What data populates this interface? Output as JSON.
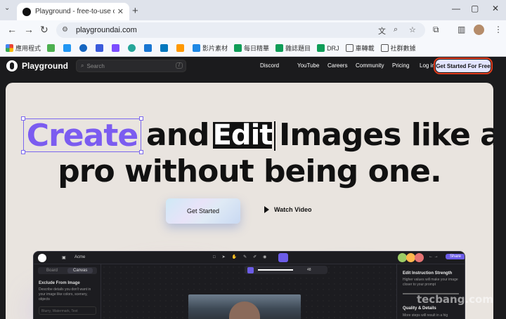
{
  "browser": {
    "tab_title": "Playground - free-to-use onli",
    "url": "playgroundai.com",
    "bookmarks": [
      "應用程式",
      "影片素材",
      "每日精華",
      "雜誌題目",
      "DRJ",
      "車轉載",
      "社群數據"
    ]
  },
  "site": {
    "logo": "Playground",
    "search_placeholder": "Search",
    "search_shortcut": "/",
    "nav": [
      "Discord",
      "YouTube",
      "Careers",
      "Community",
      "Pricing",
      "Log in"
    ],
    "cta": "Get Started For Free"
  },
  "hero": {
    "word_create": "Create",
    "word_and": "and",
    "word_edit": "Edit",
    "line1_rest": "Images like a",
    "line2": "pro without being one.",
    "get_started": "Get Started",
    "watch_video": "Watch Video"
  },
  "app_preview": {
    "project": "Acme",
    "tab_board": "Board",
    "tab_canvas": "Canvas",
    "exclude_title": "Exclude From Image",
    "exclude_desc": "Describe details you don't want in your image like colors, scenery, objects",
    "exclude_placeholder": "Blurry, Watermark, Text",
    "zoom_value": "48",
    "share": "Share",
    "edit_strength": "Edit Instruction Strength",
    "edit_strength_desc": "Higher values will make your image closer to your prompt",
    "quality": "Quality & Details",
    "quality_desc": "More steps will result in a hig"
  },
  "watermark": {
    "brand": "tecbang.com"
  },
  "colors": {
    "accent": "#7b5cf0",
    "cta_highlight": "#e23b1c",
    "hero_bg": "#e9e4df"
  }
}
